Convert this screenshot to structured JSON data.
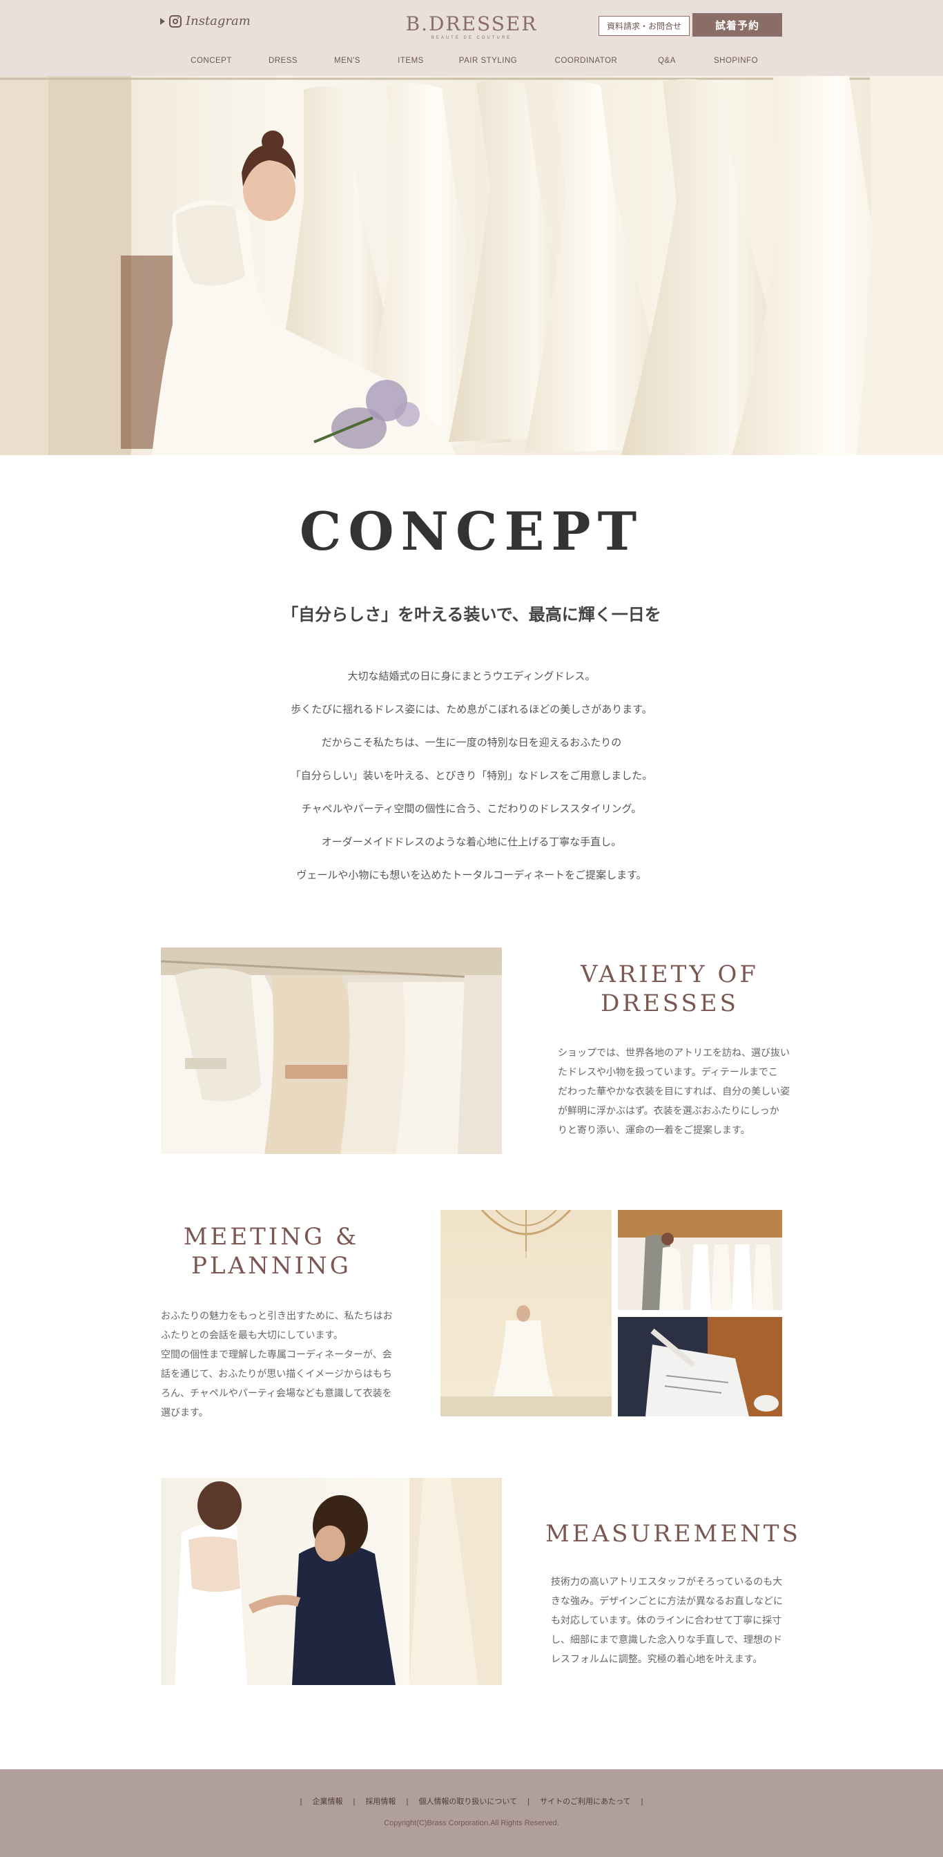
{
  "header": {
    "instagram_label": "Instagram",
    "logo_main": "B.DRESSER",
    "logo_sub": "BEAUTÉ DE COUTURE",
    "inquiry_label": "資料請求・お問合せ",
    "fitting_label": "試着予約",
    "nav": [
      "CONCEPT",
      "DRESS",
      "MEN'S",
      "ITEMS",
      "PAIR STYLING",
      "COORDINATOR",
      "Q&A",
      "SHOPINFO"
    ]
  },
  "concept": {
    "title": "CONCEPT",
    "subtitle": "「自分らしさ」を叶える装いで、最高に輝く一日を",
    "lines": [
      "大切な結婚式の日に身にまとうウエディングドレス。",
      "歩くたびに揺れるドレス姿には、ため息がこぼれるほどの美しさがあります。",
      "だからこそ私たちは、一生に一度の特別な日を迎えるおふたりの",
      "「自分らしい」装いを叶える、とびきり「特別」なドレスをご用意しました。",
      "チャペルやパーティ空間の個性に合う、こだわりのドレススタイリング。",
      "オーダーメイドドレスのような着心地に仕上げる丁寧な手直し。",
      "ヴェールや小物にも想いを込めたトータルコーディネートをご提案します。"
    ]
  },
  "variety": {
    "title_line1": "VARIETY OF",
    "title_line2": "DRESSES",
    "lines": [
      "ショップでは、世界各地のアトリエを訪ね、選び抜い",
      "たドレスや小物を扱っています。ディテールまでこ",
      "だわった華やかな衣装を目にすれば、自分の美しい姿",
      "が鮮明に浮かぶはず。衣装を選ぶおふたりにしっか",
      "りと寄り添い、運命の一着をご提案します。"
    ]
  },
  "meeting": {
    "title_line1": "MEETING &",
    "title_line2": "PLANNING",
    "lines": [
      "おふたりの魅力をもっと引き出すために、私たちはお",
      "ふたりとの会話を最も大切にしています。",
      "空間の個性まで理解した専属コーディネーターが、会",
      "話を通じて、おふたりが思い描くイメージからはもち",
      "ろん、チャペルやパーティ会場なども意識して衣装を",
      "選びます。"
    ]
  },
  "measurements": {
    "title": "MEASUREMENTS",
    "lines": [
      "技術力の高いアトリエスタッフがそろっているのも大",
      "きな強み。デザインごとに方法が異なるお直しなどに",
      "も対応しています。体のラインに合わせて丁寧に採寸",
      "し、細部にまで意識した念入りな手直しで、理想のド",
      "レスフォルムに調整。究極の着心地を叶えます。"
    ]
  },
  "footer": {
    "links": [
      "企業情報",
      "採用情報",
      "個人情報の取り扱いについて",
      "サイトのご利用にあたって"
    ],
    "copyright": "Copyright(C)Brass Corporation.All Rights Reserved."
  },
  "colors": {
    "header_bg": "#e9e0dc",
    "accent": "#8a6d67",
    "section_title": "#7b5752",
    "footer_bg": "#b19f9b"
  },
  "icons": [
    "play-triangle-icon",
    "instagram-icon"
  ]
}
